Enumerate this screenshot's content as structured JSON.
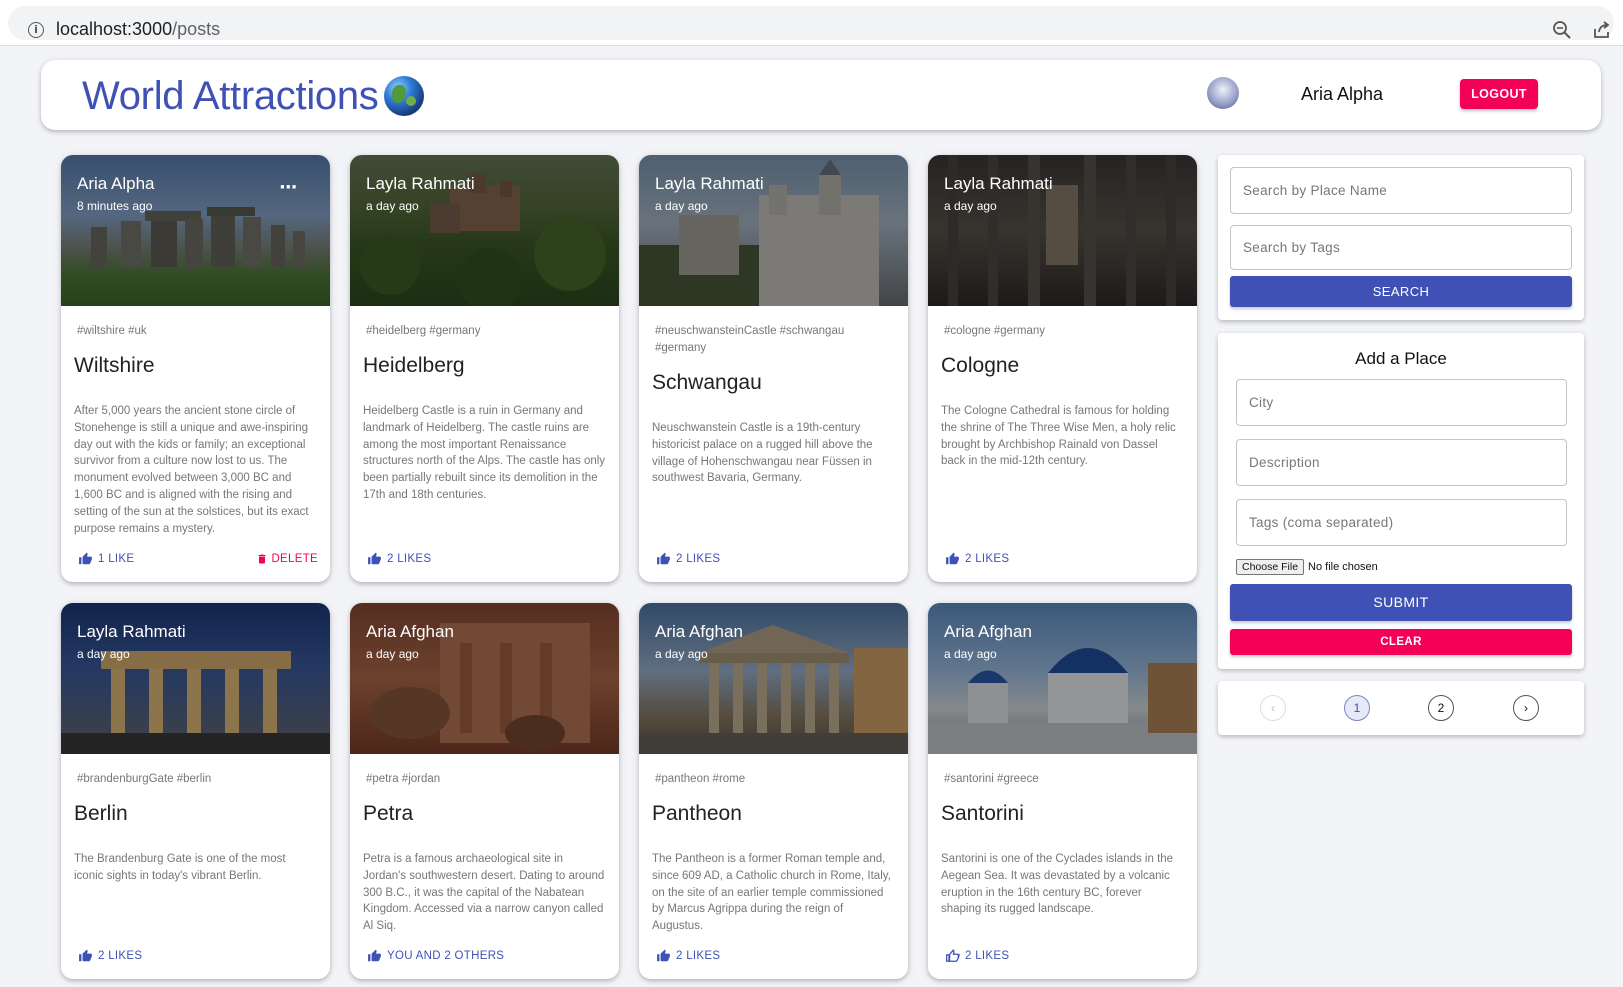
{
  "browser": {
    "url_host": "localhost:3000",
    "url_path": "/posts"
  },
  "header": {
    "title": "World Attractions",
    "user_name": "Aria Alpha",
    "logout_label": "LOGOUT"
  },
  "posts": [
    {
      "author": "Aria Alpha",
      "time": "8 minutes ago",
      "tags": "#wiltshire #uk",
      "title": "Wiltshire",
      "description": "After 5,000 years the ancient stone circle of Stonehenge is still a unique and awe-inspiring day out with the kids or family; an exceptional survivor from a culture now lost to us. The monument evolved between 3,000 BC and 1,600 BC and is aligned with the rising and setting of the sun at the solstices, but its exact purpose remains a mystery.",
      "likes": "1 LIKE",
      "delete_label": "DELETE"
    },
    {
      "author": "Layla Rahmati",
      "time": "a day ago",
      "tags": "#heidelberg #germany",
      "title": "Heidelberg",
      "description": "Heidelberg Castle is a ruin in Germany and landmark of Heidelberg. The castle ruins are among the most important Renaissance structures north of the Alps. The castle has only been partially rebuilt since its demolition in the 17th and 18th centuries.",
      "likes": "2 LIKES"
    },
    {
      "author": "Layla Rahmati",
      "time": "a day ago",
      "tags": "#neuschwansteinCastle #schwangau #germany",
      "title": "Schwangau",
      "description": "Neuschwanstein Castle is a 19th-century historicist palace on a rugged hill above the village of Hohenschwangau near Füssen in southwest Bavaria, Germany.",
      "likes": "2 LIKES"
    },
    {
      "author": "Layla Rahmati",
      "time": "a day ago",
      "tags": "#cologne #germany",
      "title": "Cologne",
      "description": "The Cologne Cathedral is famous for holding the shrine of The Three Wise Men, a holy relic brought by Archbishop Rainald von Dassel back in the mid-12th century.",
      "likes": "2 LIKES"
    },
    {
      "author": "Layla Rahmati",
      "time": "a day ago",
      "tags": "#brandenburgGate #berlin",
      "title": "Berlin",
      "description": "The Brandenburg Gate is one of the most iconic sights in today's vibrant Berlin.",
      "likes": "2 LIKES"
    },
    {
      "author": "Aria Afghan",
      "time": "a day ago",
      "tags": "#petra #jordan",
      "title": "Petra",
      "description": "Petra is a famous archaeological site in Jordan's southwestern desert. Dating to around 300 B.C., it was the capital of the Nabatean Kingdom. Accessed via a narrow canyon called Al Siq.",
      "likes": "YOU AND 2 OTHERS"
    },
    {
      "author": "Aria Afghan",
      "time": "a day ago",
      "tags": "#pantheon #rome",
      "title": "Pantheon",
      "description": "The Pantheon is a former Roman temple and, since 609 AD, a Catholic church in Rome, Italy, on the site of an earlier temple commissioned by Marcus Agrippa during the reign of Augustus.",
      "likes": "2 LIKES"
    },
    {
      "author": "Aria Afghan",
      "time": "a day ago",
      "tags": "#santorini #greece",
      "title": "Santorini",
      "description": "Santorini is one of the Cyclades islands in the Aegean Sea. It was devastated by a volcanic eruption in the 16th century BC, forever shaping its rugged landscape.",
      "likes": "2 LIKES"
    }
  ],
  "search": {
    "place_placeholder": "Search by Place Name",
    "tags_placeholder": "Search by Tags",
    "button_label": "SEARCH"
  },
  "form": {
    "title": "Add a Place",
    "city_placeholder": "City",
    "description_placeholder": "Description",
    "tags_placeholder": "Tags (coma separated)",
    "file_button": "Choose File",
    "file_status": "No file chosen",
    "submit_label": "SUBMIT",
    "clear_label": "CLEAR"
  },
  "pagination": {
    "prev": "‹",
    "pages": [
      "1",
      "2"
    ],
    "current": "1",
    "next": "›"
  },
  "colors": {
    "primary": "#3f51b5",
    "secondary": "#f50057"
  }
}
